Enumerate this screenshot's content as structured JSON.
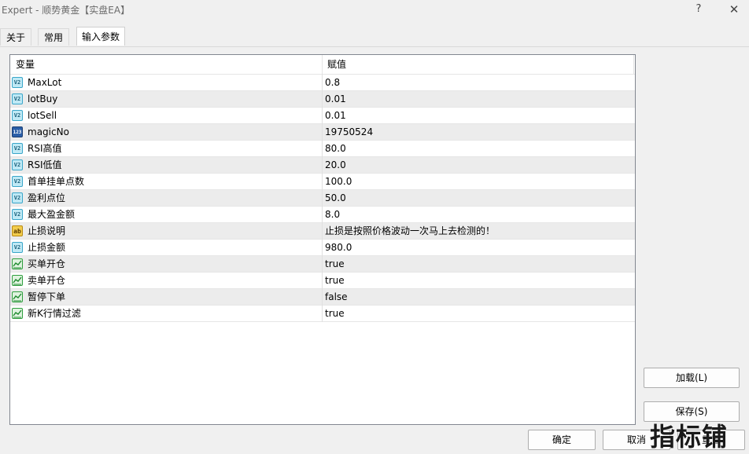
{
  "window": {
    "title": "Expert - 顺势黄金【实盘EA】",
    "help_symbol": "?",
    "close_symbol": "✕"
  },
  "tabs": [
    {
      "label": "关于"
    },
    {
      "label": "常用"
    },
    {
      "label": "输入参数",
      "active": true
    }
  ],
  "grid": {
    "headers": {
      "variable": "变量",
      "value": "赋值"
    },
    "rows": [
      {
        "type_icon": "double-icon",
        "icon_text": "V2",
        "name": "MaxLot",
        "value": "0.8"
      },
      {
        "type_icon": "double-icon",
        "icon_text": "V2",
        "name": "lotBuy",
        "value": "0.01"
      },
      {
        "type_icon": "double-icon",
        "icon_text": "V2",
        "name": "lotSell",
        "value": "0.01"
      },
      {
        "type_icon": "integer-icon",
        "icon_text": "123",
        "name": "magicNo",
        "value": "19750524"
      },
      {
        "type_icon": "double-icon",
        "icon_text": "V2",
        "name": "RSI高值",
        "value": "80.0"
      },
      {
        "type_icon": "double-icon",
        "icon_text": "V2",
        "name": "RSI低值",
        "value": "20.0"
      },
      {
        "type_icon": "double-icon",
        "icon_text": "V2",
        "name": "首单挂单点数",
        "value": "100.0"
      },
      {
        "type_icon": "double-icon",
        "icon_text": "V2",
        "name": "盈利点位",
        "value": "50.0"
      },
      {
        "type_icon": "double-icon",
        "icon_text": "V2",
        "name": "最大盈金额",
        "value": "8.0"
      },
      {
        "type_icon": "string-icon",
        "icon_text": "ab",
        "name": "止损说明",
        "value": "止损是按照价格波动一次马上去检测的！"
      },
      {
        "type_icon": "double-icon",
        "icon_text": "V2",
        "name": "止损金额",
        "value": "980.0"
      },
      {
        "type_icon": "bool-icon",
        "icon_text": "",
        "name": "买单开仓",
        "value": "true"
      },
      {
        "type_icon": "bool-icon",
        "icon_text": "",
        "name": "卖单开仓",
        "value": "true"
      },
      {
        "type_icon": "bool-icon",
        "icon_text": "",
        "name": "暂停下单",
        "value": "false"
      },
      {
        "type_icon": "bool-icon",
        "icon_text": "",
        "name": "新K行情过滤",
        "value": "true"
      }
    ]
  },
  "buttons": {
    "load": "加载(L)",
    "save": "保存(S)",
    "ok": "确定",
    "cancel": "取消",
    "reset": "重置"
  },
  "watermark": "指标铺"
}
